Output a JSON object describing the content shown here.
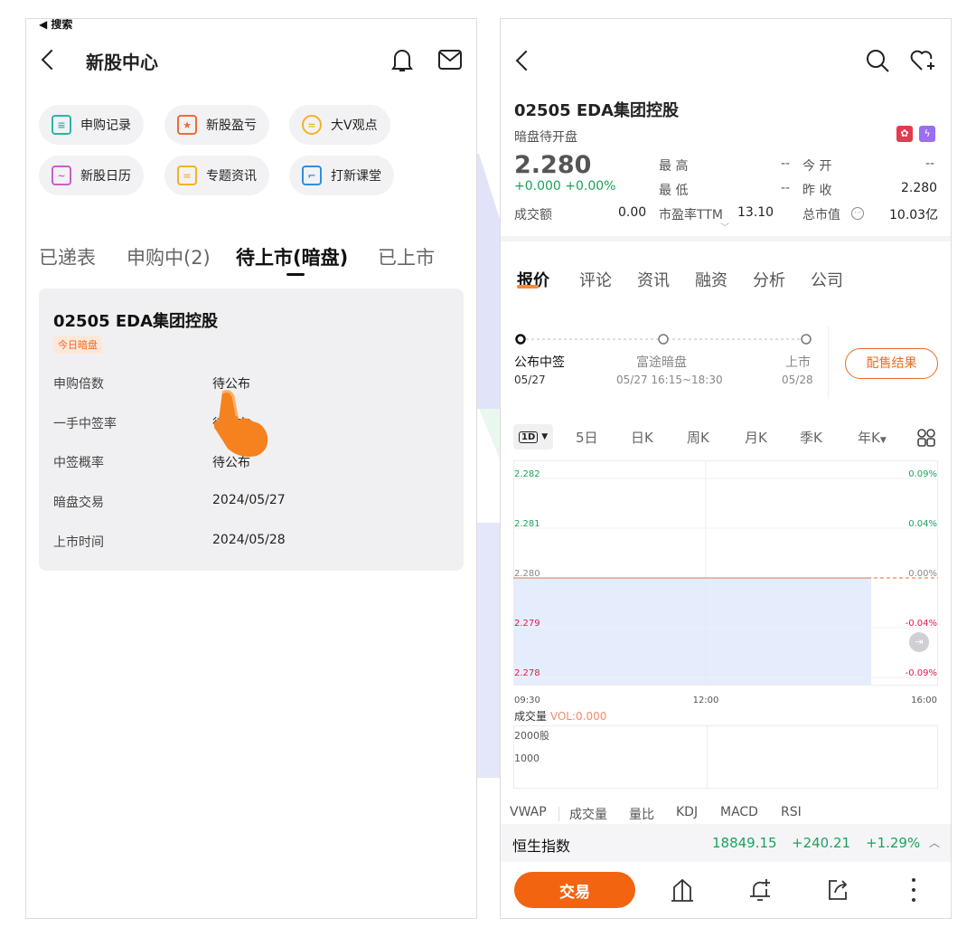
{
  "left": {
    "top_back": "◀ 搜索",
    "title": "新股中心",
    "shortcuts": [
      {
        "label": "申购记录",
        "icon_color": "#2db5a5"
      },
      {
        "label": "新股盈亏",
        "icon_color": "#f06a3a"
      },
      {
        "label": "大V观点",
        "icon_color": "#f0b326"
      },
      {
        "label": "新股日历",
        "icon_color": "#c95ec9"
      },
      {
        "label": "专题资讯",
        "icon_color": "#f0b326"
      },
      {
        "label": "打新课堂",
        "icon_color": "#2e8fe0"
      }
    ],
    "tabs": [
      "已递表",
      "申购中(2)",
      "待上市(暗盘)",
      "已上市"
    ],
    "card": {
      "name": "02505  EDA集团控股",
      "tag": "今日暗盘",
      "rows": [
        {
          "k": "申购倍数",
          "v": "待公布"
        },
        {
          "k": "一手中签率",
          "v": "待公布"
        },
        {
          "k": "中签概率",
          "v": "待公布"
        },
        {
          "k": "暗盘交易",
          "v": "2024/05/27"
        },
        {
          "k": "上市时间",
          "v": "2024/05/28"
        }
      ]
    }
  },
  "right": {
    "code_name": "02505  EDA集团控股",
    "status": "暗盘待开盘",
    "price": "2.280",
    "change": "+0.000 +0.00%",
    "stats": {
      "high_label": "最  高",
      "high_val": "--",
      "open_label": "今  开",
      "open_val": "--",
      "low_label": "最  低",
      "low_val": "--",
      "prev_label": "昨  收",
      "prev_val": "2.280",
      "turnover_label": "成交额",
      "turnover_val": "0.00",
      "pe_label": "市盈率TTM",
      "pe_val": "13.10",
      "mcap_label": "总市值",
      "mcap_val": "10.03亿"
    },
    "tabs": [
      "报价",
      "评论",
      "资讯",
      "融资",
      "分析",
      "公司"
    ],
    "timeline": [
      {
        "label": "公布中签",
        "date": "05/27"
      },
      {
        "label": "富途暗盘",
        "date": "05/27 16:15~18:30"
      },
      {
        "label": "上市",
        "date": "05/28"
      }
    ],
    "placement_btn": "配售结果",
    "ktabs": [
      "1D",
      "5日",
      "日K",
      "周K",
      "月K",
      "季K",
      "年K"
    ],
    "chart_data": {
      "type": "line",
      "y_ticks": [
        "2.282",
        "2.281",
        "2.280",
        "2.279",
        "2.278"
      ],
      "pct_ticks": [
        "0.09%",
        "0.04%",
        "0.00%",
        "-0.04%",
        "-0.09%"
      ],
      "x_ticks": [
        "09:30",
        "12:00",
        "16:00"
      ],
      "ylim": [
        2.278,
        2.282
      ],
      "reference_price": 2.28
    },
    "volume_label": "成交量",
    "volume_value": "VOL:0.000",
    "vol_ticks": [
      "2000股",
      "1000"
    ],
    "indicators": [
      "VWAP",
      "成交量",
      "量比",
      "KDJ",
      "MACD",
      "RSI"
    ],
    "index_name": "恒生指数",
    "index_value": "18849.15",
    "index_change": "+240.21",
    "index_pct": "+1.29%",
    "trade_btn": "交易"
  }
}
